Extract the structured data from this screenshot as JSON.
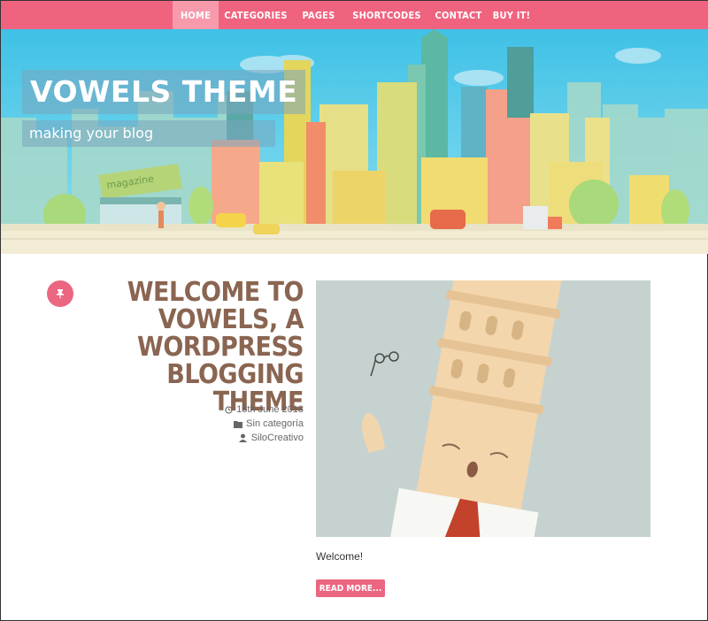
{
  "nav": {
    "items": [
      {
        "label": "Home",
        "active": true
      },
      {
        "label": "Categories",
        "active": false
      },
      {
        "label": "Pages",
        "active": false
      },
      {
        "label": "Shortcodes",
        "active": false
      },
      {
        "label": "Contact",
        "active": false
      },
      {
        "label": "Buy it!",
        "active": false
      }
    ]
  },
  "header": {
    "site_title": "Vowels Theme",
    "tagline": "making your blog",
    "illustration_sign": "magazine"
  },
  "post": {
    "pin_icon": "pin-icon",
    "title": "Welcome to Vowels, a WordPress Blogging Theme",
    "date": "18th June 2013",
    "category": "Sin categoría",
    "author": "SiloCreativo",
    "excerpt": "Welcome!",
    "read_more": "Read more..."
  },
  "colors": {
    "accent": "#f0637f",
    "title_brown": "#8a6551",
    "sky": "#3fc1e6"
  }
}
